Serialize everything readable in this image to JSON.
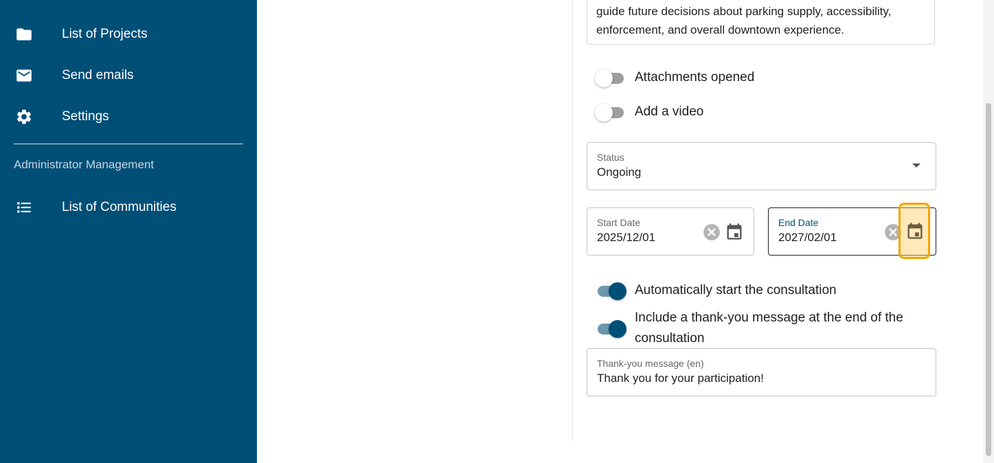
{
  "sidebar": {
    "items": [
      {
        "label": "List of Projects",
        "icon": "folder-icon"
      },
      {
        "label": "Send emails",
        "icon": "mail-icon"
      },
      {
        "label": "Settings",
        "icon": "gear-icon"
      }
    ],
    "section_label": "Administrator Management",
    "admin_items": [
      {
        "label": "List of Communities",
        "icon": "list-icon"
      }
    ]
  },
  "form": {
    "description_text": "guide future decisions about parking supply, accessibility, enforcement, and overall downtown experience.",
    "toggles": [
      {
        "label": "Attachments opened",
        "on": false
      },
      {
        "label": "Add a video",
        "on": false
      },
      {
        "label": "Automatically start the consultation",
        "on": true
      },
      {
        "label": "Include a thank-you message at the end of the consultation",
        "on": true
      }
    ],
    "status": {
      "label": "Status",
      "value": "Ongoing"
    },
    "start_date": {
      "label": "Start Date",
      "value": "2025/12/01"
    },
    "end_date": {
      "label": "End Date",
      "value": "2027/02/01"
    },
    "thank_you": {
      "label": "Thank-you message (en)",
      "value": "Thank you for your participation!"
    }
  },
  "colors": {
    "sidebar_bg": "#004f77",
    "accent": "#004f77",
    "highlight": "#f5a300"
  }
}
